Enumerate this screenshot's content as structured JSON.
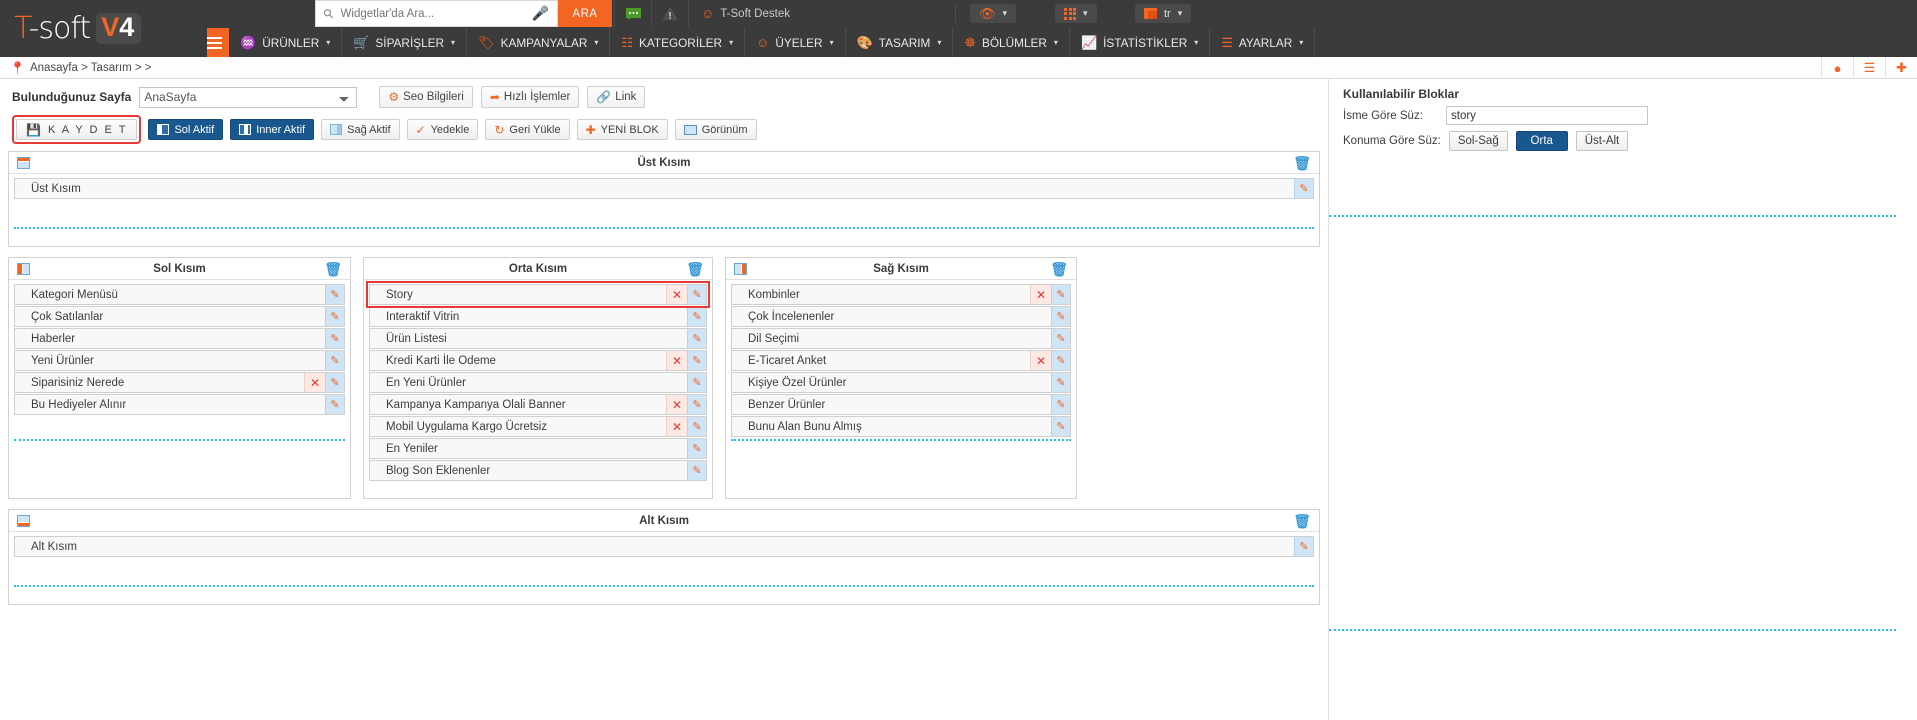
{
  "topbar": {
    "logo_main": "T-soft",
    "logo_t": "T",
    "logo_rest": "-soft",
    "logo_badge_v": "V",
    "logo_badge_4": "4",
    "search_placeholder": "Widgetlar'da Ara...",
    "search_value": "",
    "search_icon": "search-icon",
    "mic_icon": "microphone-icon",
    "ara_label": "ARA",
    "chat_icon": "chat-bubble-icon",
    "warning_icon": "warning-triangle-icon",
    "user_icon": "user-icon",
    "user_label": "T-Soft Destek",
    "eye_icon": "eye-icon",
    "grid_icon": "grid-icon",
    "lang_icon": "flag-icon",
    "lang_label": "tr",
    "caret": "⌄"
  },
  "menu": {
    "burger_icon": "hamburger-menu-icon",
    "items": [
      {
        "label": "ÜRÜNLER",
        "icon": "shirt-icon",
        "glyph": "♟"
      },
      {
        "label": "SİPARİŞLER",
        "icon": "cart-icon",
        "glyph": "⛟"
      },
      {
        "label": "KAMPANYALAR",
        "icon": "tag-icon",
        "glyph": "⚑"
      },
      {
        "label": "KATEGORİLER",
        "icon": "sitemap-icon",
        "glyph": "☷"
      },
      {
        "label": "ÜYELER",
        "icon": "users-icon",
        "glyph": "☺"
      },
      {
        "label": "TASARIM",
        "icon": "brush-icon",
        "glyph": "✐"
      },
      {
        "label": "BÖLÜMLER",
        "icon": "nodes-icon",
        "glyph": "☸"
      },
      {
        "label": "İSTATİSTİKLER",
        "icon": "chart-icon",
        "glyph": "↗"
      },
      {
        "label": "AYARLAR",
        "icon": "sliders-icon",
        "glyph": "≡"
      }
    ]
  },
  "breadcrumb": {
    "pin_icon": "location-pin-icon",
    "text": "Anasayfa > Tasarım >  >",
    "actions": [
      {
        "icon": "play-circle-icon",
        "glyph": "▶"
      },
      {
        "icon": "note-icon",
        "glyph": "▤"
      },
      {
        "icon": "globe-plus-icon",
        "glyph": "⊕"
      }
    ]
  },
  "toolbar_row1": {
    "page_label": "Bulunduğunuz Sayfa",
    "page_selected": "AnaSayfa",
    "page_options": [
      "AnaSayfa"
    ],
    "buttons": [
      {
        "label": "Seo Bilgileri",
        "icon": "seo-gear-icon",
        "glyph": "⚙"
      },
      {
        "label": "Hızlı İşlemler",
        "icon": "quick-actions-icon",
        "glyph": "↪"
      },
      {
        "label": "Link",
        "icon": "link-icon",
        "glyph": "ὑ7"
      }
    ]
  },
  "toolbar_row2": {
    "buttons": [
      {
        "label": "K A Y D E T",
        "icon": "save-icon",
        "style": "highlighted"
      },
      {
        "label": "Sol Aktif",
        "icon": "left-layout-icon",
        "style": "blue"
      },
      {
        "label": "Inner Aktif",
        "icon": "inner-layout-icon",
        "style": "blue"
      },
      {
        "label": "Sağ Aktif",
        "icon": "right-layout-icon",
        "style": "default"
      },
      {
        "label": "Yedekle",
        "icon": "backup-icon",
        "style": "default"
      },
      {
        "label": "Geri Yükle",
        "icon": "restore-icon",
        "style": "default"
      },
      {
        "label": "YENİ BLOK",
        "icon": "plus-circle-icon",
        "style": "default"
      },
      {
        "label": "Görünüm",
        "icon": "monitor-icon",
        "style": "default"
      }
    ]
  },
  "sections": {
    "top": {
      "title": "Üst Kısım",
      "layout_icon": "layout-top-icon",
      "trash_icon": "trash-icon",
      "blocks": [
        {
          "label": "Üst Kısım",
          "removable": false,
          "editable": true,
          "highlight": false
        }
      ]
    },
    "left": {
      "title": "Sol Kısım",
      "layout_icon": "layout-left-icon",
      "trash_icon": "trash-icon",
      "blocks": [
        {
          "label": "Kategori Menüsü",
          "removable": false,
          "editable": true,
          "highlight": false
        },
        {
          "label": "Çok Satılanlar",
          "removable": false,
          "editable": true,
          "highlight": false
        },
        {
          "label": "Haberler",
          "removable": false,
          "editable": true,
          "highlight": false
        },
        {
          "label": "Yeni Ürünler",
          "removable": false,
          "editable": true,
          "highlight": false
        },
        {
          "label": "Siparisiniz Nerede",
          "removable": true,
          "editable": true,
          "highlight": false
        },
        {
          "label": "Bu Hediyeler Alınır",
          "removable": false,
          "editable": true,
          "highlight": false
        }
      ]
    },
    "middle": {
      "title": "Orta Kısım",
      "layout_icon": "layout-middle-icon",
      "trash_icon": "trash-icon",
      "blocks": [
        {
          "label": "Story",
          "removable": true,
          "editable": true,
          "highlight": true
        },
        {
          "label": "Interaktif Vitrin",
          "removable": false,
          "editable": true,
          "highlight": false
        },
        {
          "label": "Ürün Listesi",
          "removable": false,
          "editable": true,
          "highlight": false
        },
        {
          "label": "Kredi Karti İle Odeme",
          "removable": true,
          "editable": true,
          "highlight": false
        },
        {
          "label": "En Yeni Ürünler",
          "removable": false,
          "editable": true,
          "highlight": false
        },
        {
          "label": "Kampanya Kampanya Olali Banner",
          "removable": true,
          "editable": true,
          "highlight": false
        },
        {
          "label": "Mobil Uygulama Kargo Ücretsiz",
          "removable": true,
          "editable": true,
          "highlight": false
        },
        {
          "label": "En Yeniler",
          "removable": false,
          "editable": true,
          "highlight": false
        },
        {
          "label": "Blog Son Eklenenler",
          "removable": false,
          "editable": true,
          "highlight": false
        }
      ]
    },
    "right": {
      "title": "Sağ Kısım",
      "layout_icon": "layout-right-icon",
      "trash_icon": "trash-icon",
      "blocks": [
        {
          "label": "Kombinler",
          "removable": true,
          "editable": true,
          "highlight": false
        },
        {
          "label": "Çok İncelenenler",
          "removable": false,
          "editable": true,
          "highlight": false
        },
        {
          "label": "Dil Seçimi",
          "removable": false,
          "editable": true,
          "highlight": false
        },
        {
          "label": "E-Ticaret Anket",
          "removable": true,
          "editable": true,
          "highlight": false
        },
        {
          "label": "Kişiye Özel Ürünler",
          "removable": false,
          "editable": true,
          "highlight": false
        },
        {
          "label": "Benzer Ürünler",
          "removable": false,
          "editable": true,
          "highlight": false
        },
        {
          "label": "Bunu Alan Bunu Almış",
          "removable": false,
          "editable": true,
          "highlight": false
        }
      ]
    },
    "bottom": {
      "title": "Alt Kısım",
      "layout_icon": "layout-bottom-icon",
      "trash_icon": "trash-icon",
      "blocks": [
        {
          "label": "Alt Kısım",
          "removable": false,
          "editable": true,
          "highlight": false
        }
      ]
    }
  },
  "right_panel": {
    "title": "Kullanılabilir Bloklar",
    "name_filter_label": "İsme Göre Süz:",
    "name_filter_value": "story",
    "location_filter_label": "Konuma Göre Süz:",
    "location_buttons": [
      {
        "label": "Sol-Sağ",
        "active": false
      },
      {
        "label": "Orta",
        "active": true
      },
      {
        "label": "Üst-Alt",
        "active": false
      }
    ]
  },
  "colors": {
    "accent": "#f26522",
    "dark": "#3b3b3b",
    "blue": "#19578f",
    "lightblue": "#cfe4f5",
    "danger": "#e53935",
    "dashed": "#28c0e8"
  }
}
